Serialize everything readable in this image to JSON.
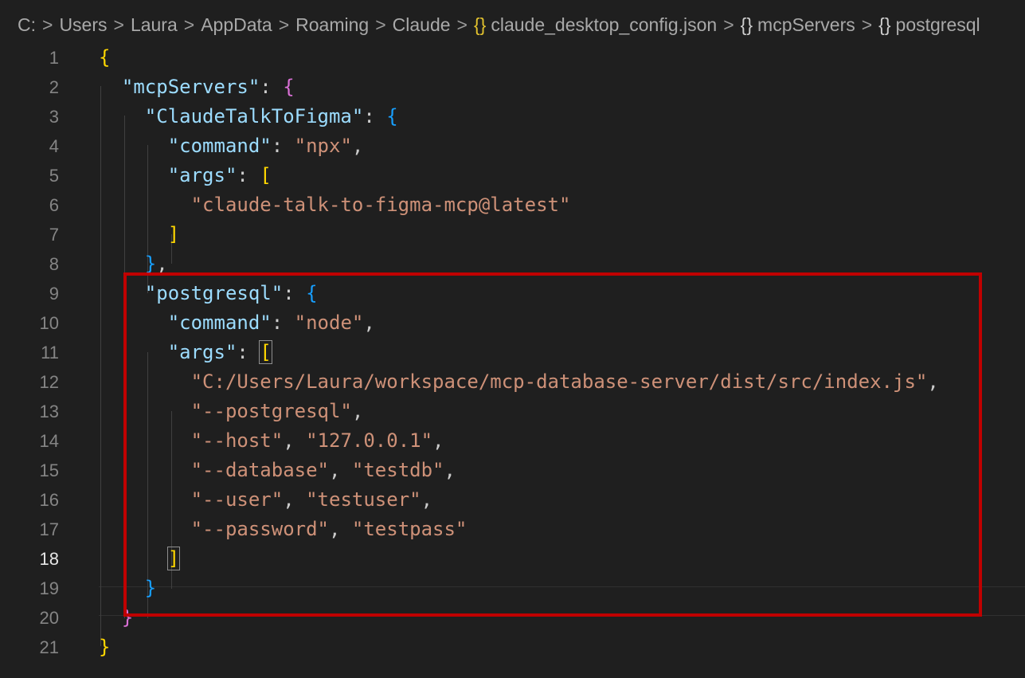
{
  "breadcrumb": {
    "items": [
      {
        "label": "C:",
        "icon": ""
      },
      {
        "label": "Users",
        "icon": ""
      },
      {
        "label": "Laura",
        "icon": ""
      },
      {
        "label": "AppData",
        "icon": ""
      },
      {
        "label": "Roaming",
        "icon": ""
      },
      {
        "label": "Claude",
        "icon": ""
      },
      {
        "label": "claude_desktop_config.json",
        "icon": "{}"
      },
      {
        "label": "mcpServers",
        "icon": "{}"
      },
      {
        "label": "postgresql",
        "icon": "{}"
      }
    ],
    "separator": ">"
  },
  "editor": {
    "active_line": 18,
    "lines": [
      {
        "num": "1",
        "indent": "",
        "tokens": [
          {
            "t": "{",
            "c": "br-y"
          }
        ]
      },
      {
        "num": "2",
        "indent": "  ",
        "tokens": [
          {
            "t": "\"mcpServers\"",
            "c": "tok-key"
          },
          {
            "t": ": ",
            "c": "tok-p"
          },
          {
            "t": "{",
            "c": "br-p"
          }
        ]
      },
      {
        "num": "3",
        "indent": "    ",
        "tokens": [
          {
            "t": "\"ClaudeTalkToFigma\"",
            "c": "tok-key"
          },
          {
            "t": ": ",
            "c": "tok-p"
          },
          {
            "t": "{",
            "c": "br-b"
          }
        ]
      },
      {
        "num": "4",
        "indent": "      ",
        "tokens": [
          {
            "t": "\"command\"",
            "c": "tok-key"
          },
          {
            "t": ": ",
            "c": "tok-p"
          },
          {
            "t": "\"npx\"",
            "c": "tok-str"
          },
          {
            "t": ",",
            "c": "tok-p"
          }
        ]
      },
      {
        "num": "5",
        "indent": "      ",
        "tokens": [
          {
            "t": "\"args\"",
            "c": "tok-key"
          },
          {
            "t": ": ",
            "c": "tok-p"
          },
          {
            "t": "[",
            "c": "br-y"
          }
        ]
      },
      {
        "num": "6",
        "indent": "        ",
        "tokens": [
          {
            "t": "\"claude-talk-to-figma-mcp@latest\"",
            "c": "tok-str"
          }
        ]
      },
      {
        "num": "7",
        "indent": "      ",
        "tokens": [
          {
            "t": "]",
            "c": "br-y"
          }
        ]
      },
      {
        "num": "8",
        "indent": "    ",
        "tokens": [
          {
            "t": "}",
            "c": "br-b"
          },
          {
            "t": ",",
            "c": "tok-p"
          }
        ]
      },
      {
        "num": "9",
        "indent": "    ",
        "tokens": [
          {
            "t": "\"postgresql\"",
            "c": "tok-key"
          },
          {
            "t": ": ",
            "c": "tok-p"
          },
          {
            "t": "{",
            "c": "br-b"
          }
        ]
      },
      {
        "num": "10",
        "indent": "      ",
        "tokens": [
          {
            "t": "\"command\"",
            "c": "tok-key"
          },
          {
            "t": ": ",
            "c": "tok-p"
          },
          {
            "t": "\"node\"",
            "c": "tok-str"
          },
          {
            "t": ",",
            "c": "tok-p"
          }
        ]
      },
      {
        "num": "11",
        "indent": "      ",
        "tokens": [
          {
            "t": "\"args\"",
            "c": "tok-key"
          },
          {
            "t": ": ",
            "c": "tok-p"
          },
          {
            "t": "[",
            "c": "br-y box-br"
          }
        ]
      },
      {
        "num": "12",
        "indent": "        ",
        "tokens": [
          {
            "t": "\"C:/Users/Laura/workspace/mcp-database-server/dist/src/index.js\"",
            "c": "tok-str"
          },
          {
            "t": ",",
            "c": "tok-p"
          }
        ]
      },
      {
        "num": "13",
        "indent": "        ",
        "tokens": [
          {
            "t": "\"--postgresql\"",
            "c": "tok-str"
          },
          {
            "t": ",",
            "c": "tok-p"
          }
        ]
      },
      {
        "num": "14",
        "indent": "        ",
        "tokens": [
          {
            "t": "\"--host\"",
            "c": "tok-str"
          },
          {
            "t": ", ",
            "c": "tok-p"
          },
          {
            "t": "\"127.0.0.1\"",
            "c": "tok-str"
          },
          {
            "t": ",",
            "c": "tok-p"
          }
        ]
      },
      {
        "num": "15",
        "indent": "        ",
        "tokens": [
          {
            "t": "\"--database\"",
            "c": "tok-str"
          },
          {
            "t": ", ",
            "c": "tok-p"
          },
          {
            "t": "\"testdb\"",
            "c": "tok-str"
          },
          {
            "t": ",",
            "c": "tok-p"
          }
        ]
      },
      {
        "num": "16",
        "indent": "        ",
        "tokens": [
          {
            "t": "\"--user\"",
            "c": "tok-str"
          },
          {
            "t": ", ",
            "c": "tok-p"
          },
          {
            "t": "\"testuser\"",
            "c": "tok-str"
          },
          {
            "t": ",",
            "c": "tok-p"
          }
        ]
      },
      {
        "num": "17",
        "indent": "        ",
        "tokens": [
          {
            "t": "\"--password\"",
            "c": "tok-str"
          },
          {
            "t": ", ",
            "c": "tok-p"
          },
          {
            "t": "\"testpass\"",
            "c": "tok-str"
          }
        ]
      },
      {
        "num": "18",
        "indent": "      ",
        "tokens": [
          {
            "t": "]",
            "c": "br-y box-br"
          }
        ]
      },
      {
        "num": "19",
        "indent": "    ",
        "tokens": [
          {
            "t": "}",
            "c": "br-b"
          }
        ]
      },
      {
        "num": "20",
        "indent": "  ",
        "tokens": [
          {
            "t": "}",
            "c": "br-p"
          }
        ]
      },
      {
        "num": "21",
        "indent": "",
        "tokens": [
          {
            "t": "}",
            "c": "br-y"
          }
        ]
      }
    ]
  },
  "colors": {
    "background": "#1f1f1f",
    "key": "#9cdcfe",
    "string": "#ce9178",
    "bracket_gold": "#ffd700",
    "bracket_pink": "#da70d6",
    "bracket_blue": "#179fff",
    "highlight_box": "#c00000"
  }
}
